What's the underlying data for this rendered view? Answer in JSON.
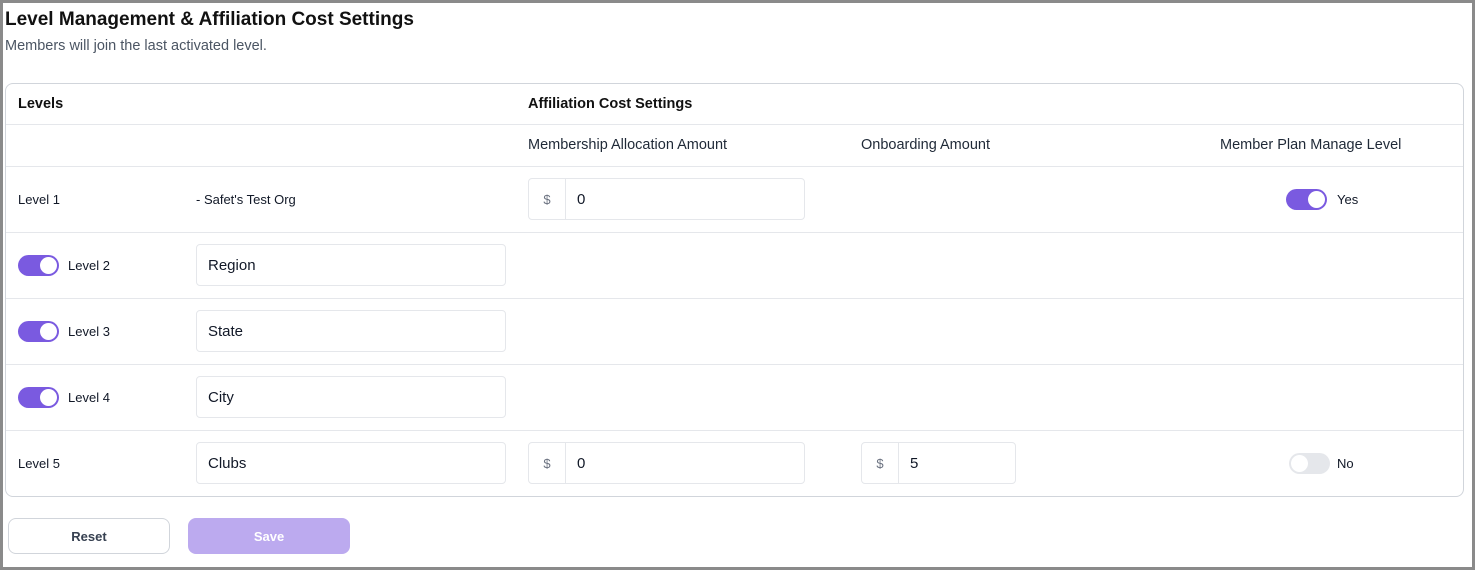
{
  "header": {
    "title": "Level Management & Affiliation Cost Settings",
    "subtitle": "Members will join the last activated level."
  },
  "table": {
    "levels_header": "Levels",
    "affiliation_header": "Affiliation Cost Settings",
    "columns": {
      "membership_allocation": "Membership Allocation Amount",
      "onboarding": "Onboarding Amount",
      "member_plan_manage": "Member Plan Manage Level"
    },
    "currency_symbol": "$",
    "rows": [
      {
        "label": "Level 1",
        "has_toggle": false,
        "org_name": "- Safet's Test Org",
        "membership_allocation": "0",
        "manage_level": {
          "enabled": true,
          "label": "Yes"
        }
      },
      {
        "label": "Level 2",
        "has_toggle": true,
        "toggle_on": true,
        "name": "Region"
      },
      {
        "label": "Level 3",
        "has_toggle": true,
        "toggle_on": true,
        "name": "State"
      },
      {
        "label": "Level 4",
        "has_toggle": true,
        "toggle_on": true,
        "name": "City"
      },
      {
        "label": "Level 5",
        "has_toggle": false,
        "name": "Clubs",
        "membership_allocation": "0",
        "onboarding": "5",
        "manage_level": {
          "enabled": false,
          "label": "No"
        }
      }
    ]
  },
  "actions": {
    "reset_label": "Reset",
    "save_label": "Save",
    "save_disabled": true
  },
  "colors": {
    "accent": "#7a5ae0",
    "save_disabled_bg": "#bcaaef",
    "toggle_off": "#e5e7eb"
  }
}
